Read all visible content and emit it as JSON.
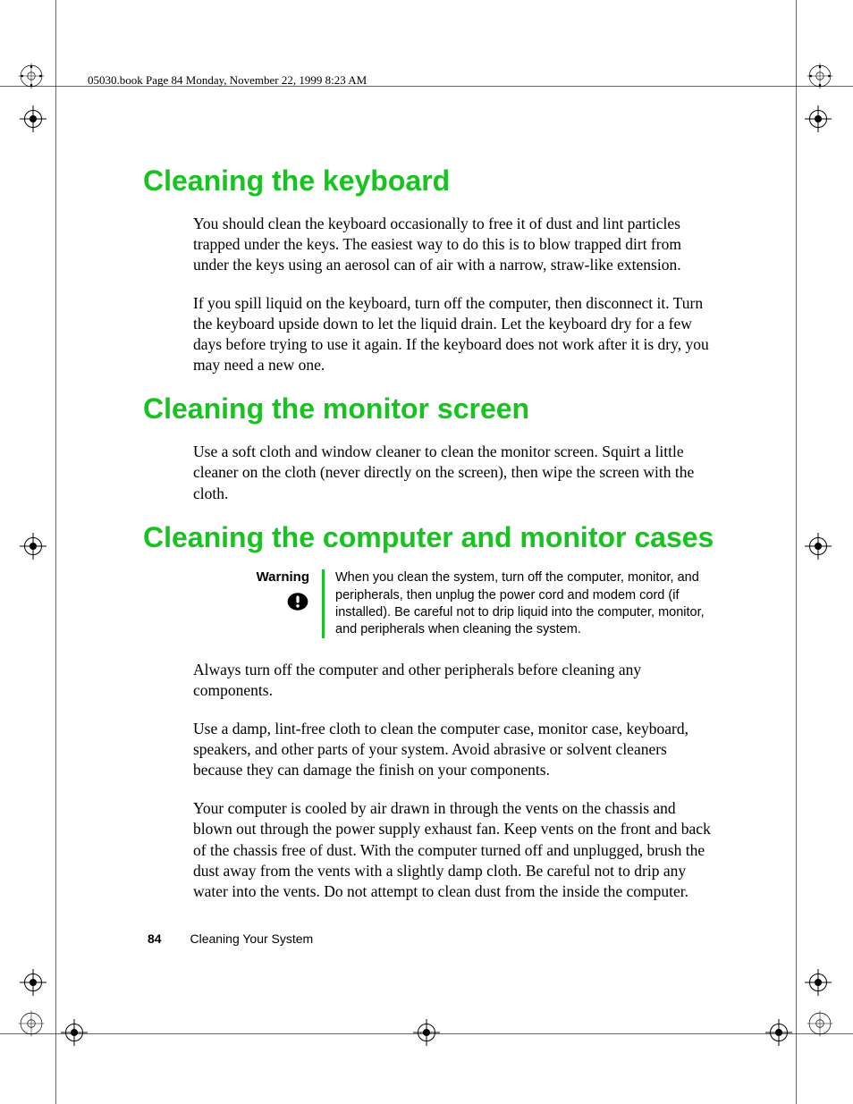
{
  "header_note": "05030.book  Page 84  Monday, November 22, 1999  8:23 AM",
  "section1": {
    "title": "Cleaning the keyboard",
    "p1": "You should clean the keyboard occasionally to free it of dust and lint particles trapped under the keys. The easiest way to do this is to blow trapped dirt from under the keys using an aerosol can of air with a narrow, straw-like extension.",
    "p2": "If you spill liquid on the keyboard, turn off the computer, then disconnect it. Turn the keyboard upside down to let the liquid drain. Let the keyboard dry for a few days before trying to use it again. If the keyboard does not work after it is dry, you may need a new one."
  },
  "section2": {
    "title": "Cleaning the monitor screen",
    "p1": "Use a soft cloth and window cleaner to clean the monitor screen. Squirt a little cleaner on the cloth (never directly on the screen), then wipe the screen with the cloth."
  },
  "section3": {
    "title": "Cleaning the computer and monitor cases",
    "warning_label": "Warning",
    "warning_text": "When you clean the system, turn off the computer, monitor, and peripherals, then unplug the power cord and modem cord (if installed). Be careful not to drip liquid into the computer, monitor, and peripherals when cleaning the system.",
    "p1": "Always turn off the computer and other peripherals before cleaning any components.",
    "p2": "Use a damp, lint-free cloth to clean the computer case, monitor case, keyboard, speakers, and other parts of your system. Avoid abrasive or solvent cleaners because they can damage the finish on your components.",
    "p3": "Your computer is cooled by air drawn in through the vents on the chassis and blown out through the power supply exhaust fan. Keep vents on the front and back of the chassis free of dust. With the computer turned off and unplugged, brush the dust away from the vents with a slightly damp cloth. Be careful not to drip any water into the vents. Do not attempt to clean dust from the inside the computer."
  },
  "footer": {
    "page_number": "84",
    "chapter": "Cleaning Your System"
  }
}
